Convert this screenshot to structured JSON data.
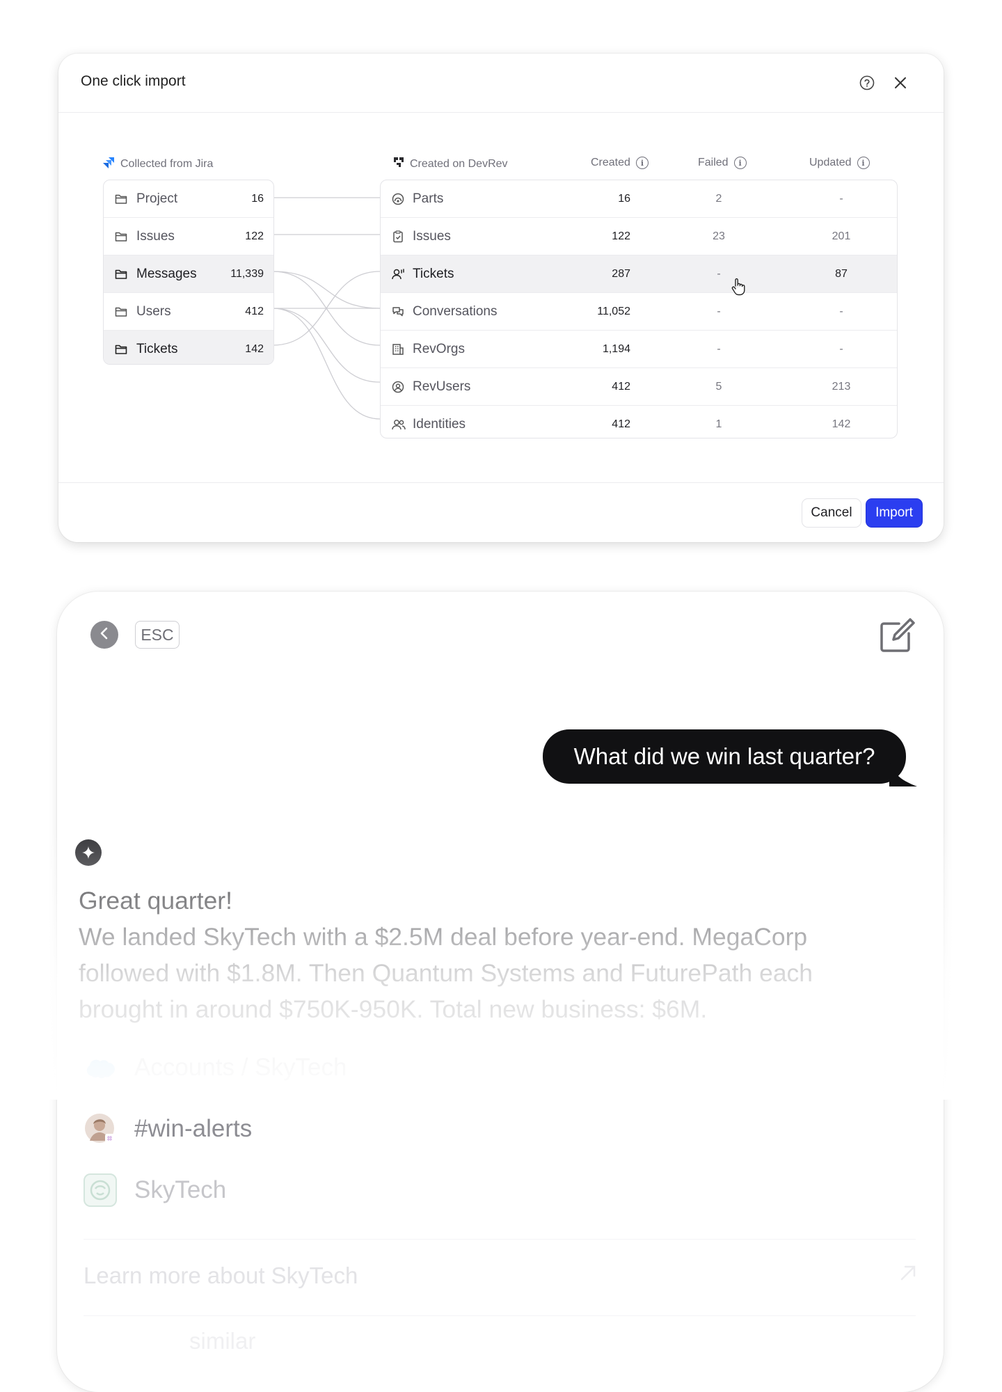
{
  "dialog": {
    "title": "One click import",
    "source_heading": "Collected from Jira",
    "dest_heading": "Created on DevRev",
    "col_created": "Created",
    "col_failed": "Failed",
    "col_updated": "Updated",
    "source_rows": [
      {
        "label": "Project",
        "count": "16"
      },
      {
        "label": "Issues",
        "count": "122"
      },
      {
        "label": "Messages",
        "count": "11,339"
      },
      {
        "label": "Users",
        "count": "412"
      },
      {
        "label": "Tickets",
        "count": "142"
      }
    ],
    "dest_rows": [
      {
        "label": "Parts",
        "icon": "parts-icon",
        "created": "16",
        "failed": "2",
        "updated": "-"
      },
      {
        "label": "Issues",
        "icon": "clipboard-icon",
        "created": "122",
        "failed": "23",
        "updated": "201"
      },
      {
        "label": "Tickets",
        "icon": "user-ticket-icon",
        "created": "287",
        "failed": "-",
        "updated": "87"
      },
      {
        "label": "Conversations",
        "icon": "chat-icon",
        "created": "11,052",
        "failed": "-",
        "updated": "-"
      },
      {
        "label": "RevOrgs",
        "icon": "building-icon",
        "created": "1,194",
        "failed": "-",
        "updated": "-"
      },
      {
        "label": "RevUsers",
        "icon": "user-circle-icon",
        "created": "412",
        "failed": "5",
        "updated": "213"
      },
      {
        "label": "Identities",
        "icon": "users-icon",
        "created": "412",
        "failed": "1",
        "updated": "142"
      }
    ],
    "cancel_label": "Cancel",
    "import_label": "Import"
  },
  "chat": {
    "esc_label": "ESC",
    "user_message": "What did we win last quarter?",
    "answer_greeting": "Great quarter!",
    "answer_body": "We landed SkyTech with a $2.5M deal before year-end. MegaCorp followed with $1.8M. Then Quantum Systems and FuturePath each brought in around $750K-950K. Total new business: $6M.",
    "sources": [
      {
        "label": "Accounts / SkyTech",
        "icon": "salesforce-icon"
      },
      {
        "label": "#win-alerts",
        "icon": "avatar-slack-icon"
      },
      {
        "label": "SkyTech",
        "icon": "skytech-logo-icon"
      }
    ],
    "followup_link": "Learn more about SkyTech",
    "followup_link_2": "similar"
  },
  "colors": {
    "accent": "#2b3ef0",
    "bubble": "#111113",
    "jira": "#2684ff",
    "salesforce": "#5fb6ef"
  }
}
